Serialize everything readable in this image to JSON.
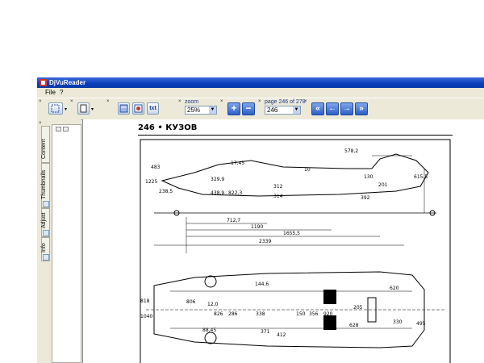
{
  "window": {
    "title": "DjVuReader"
  },
  "menu": [
    {
      "label": "File"
    },
    {
      "label": "?"
    }
  ],
  "toolbar": {
    "zoom_label": "zoom",
    "zoom_value": "25%",
    "page_label": "page 246 of 278",
    "page_value": "246",
    "text_button": "txt",
    "icons": [
      "select-icon",
      "page-layout-icon",
      "single-page-icon",
      "image-mode-icon",
      "txt-icon",
      "zoom-in-icon",
      "zoom-out-icon",
      "first-page-icon",
      "prev-page-icon",
      "next-page-icon",
      "last-page-icon"
    ]
  },
  "sidebar": {
    "tabs": [
      {
        "label": "Content"
      },
      {
        "label": "Thumbnails"
      },
      {
        "label": "Adjust"
      },
      {
        "label": "Info"
      }
    ]
  },
  "document": {
    "page_number": "246",
    "section": "КУЗОВ",
    "header": "246 • КУЗОВ",
    "dimensions_side": [
      "483",
      "1225",
      "238,5",
      "329,9",
      "438,9",
      "822,3",
      "712,7",
      "1190",
      "1655,5",
      "2339",
      "578,2",
      "10",
      "130",
      "201",
      "615,5",
      "392",
      "312",
      "314",
      "17,45"
    ],
    "dimensions_bottom": [
      "818",
      "1040",
      "806",
      "12,0",
      "826",
      "286",
      "88,45",
      "144,6",
      "338",
      "150",
      "356",
      "371",
      "412",
      "920",
      "620",
      "205",
      "628",
      "330",
      "495"
    ]
  },
  "colors": {
    "titlebar": "#0a3fb8",
    "nav_button": "#2e5fc8",
    "window_bg": "#ece9d8"
  }
}
